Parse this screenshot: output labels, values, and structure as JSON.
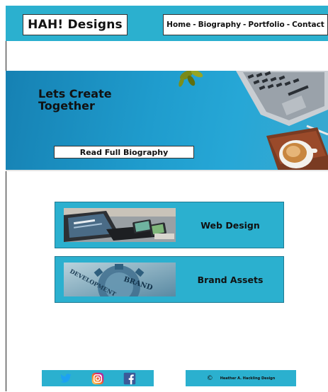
{
  "header": {
    "logo": "HAH! Designs",
    "nav": [
      {
        "label": "Home"
      },
      {
        "label": "Biography"
      },
      {
        "label": "Portfolio"
      },
      {
        "label": "Contact"
      }
    ],
    "separator": "-"
  },
  "hero": {
    "title_line1": "Lets Create",
    "title_line2": "Together",
    "bio_button": "Read Full Biography"
  },
  "services": [
    {
      "label": "Web Design"
    },
    {
      "label": "Brand Assets"
    }
  ],
  "brand_image": {
    "word1": "BRAND",
    "word2": "DEVELOPMENT"
  },
  "footer": {
    "social": [
      "twitter-icon",
      "instagram-icon",
      "facebook-icon"
    ],
    "copyright_symbol": "©",
    "copyright_text": "Heather A. Hackling Design"
  },
  "colors": {
    "accent": "#2bb0cf",
    "twitter": "#1da1f2",
    "facebook": "#3b5998"
  }
}
